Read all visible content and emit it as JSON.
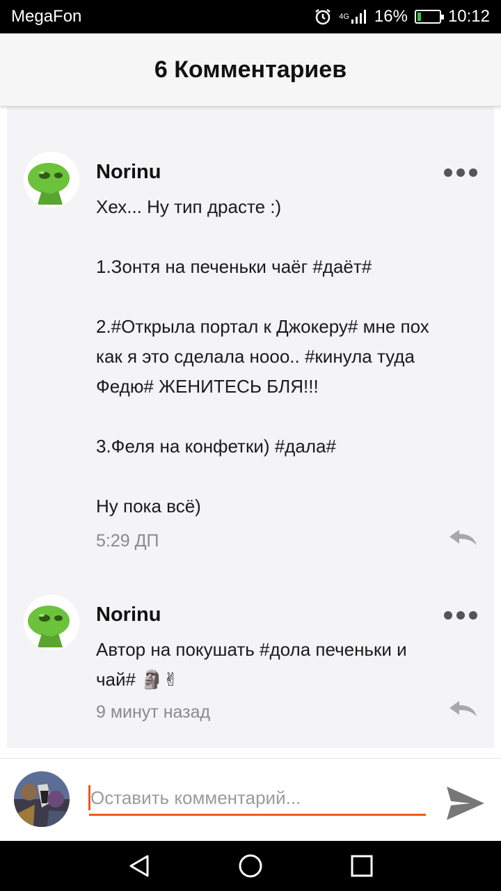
{
  "status_bar": {
    "carrier": "MegaFon",
    "network": "4G",
    "battery_percent": "16%",
    "battery_level": 0.16,
    "time": "10:12",
    "icons": [
      "alarm-icon",
      "signal-icon",
      "battery-icon"
    ]
  },
  "header": {
    "title": "6 Комментариев"
  },
  "comments": [
    {
      "author": "Norinu",
      "text": "Хех... Ну тип драсте :)\n\n1.Зонтя на печеньки чаёг #даёт#\n\n2.#Открыла портал к Джокеру# мне пох\nкак я это сделала нооо.. #кинула туда\nФедю# ЖЕНИТЕСЬ БЛЯ!!!\n\n3.Феля на конфетки) #дала#\n\nНу пока всё)",
      "time": "5:29 ДП"
    },
    {
      "author": "Norinu",
      "text": "Автор на покушать #дола печеньки и\nчай# 🗿✌",
      "time": "9 минут назад"
    }
  ],
  "input": {
    "placeholder": "Оставить комментарий...",
    "value": ""
  },
  "colors": {
    "accent": "#ee5a1c",
    "card_bg": "#f4f4f6",
    "alien_green": "#6cc23a"
  },
  "nav": {
    "icons": [
      "back-icon",
      "home-icon",
      "recents-icon"
    ]
  }
}
